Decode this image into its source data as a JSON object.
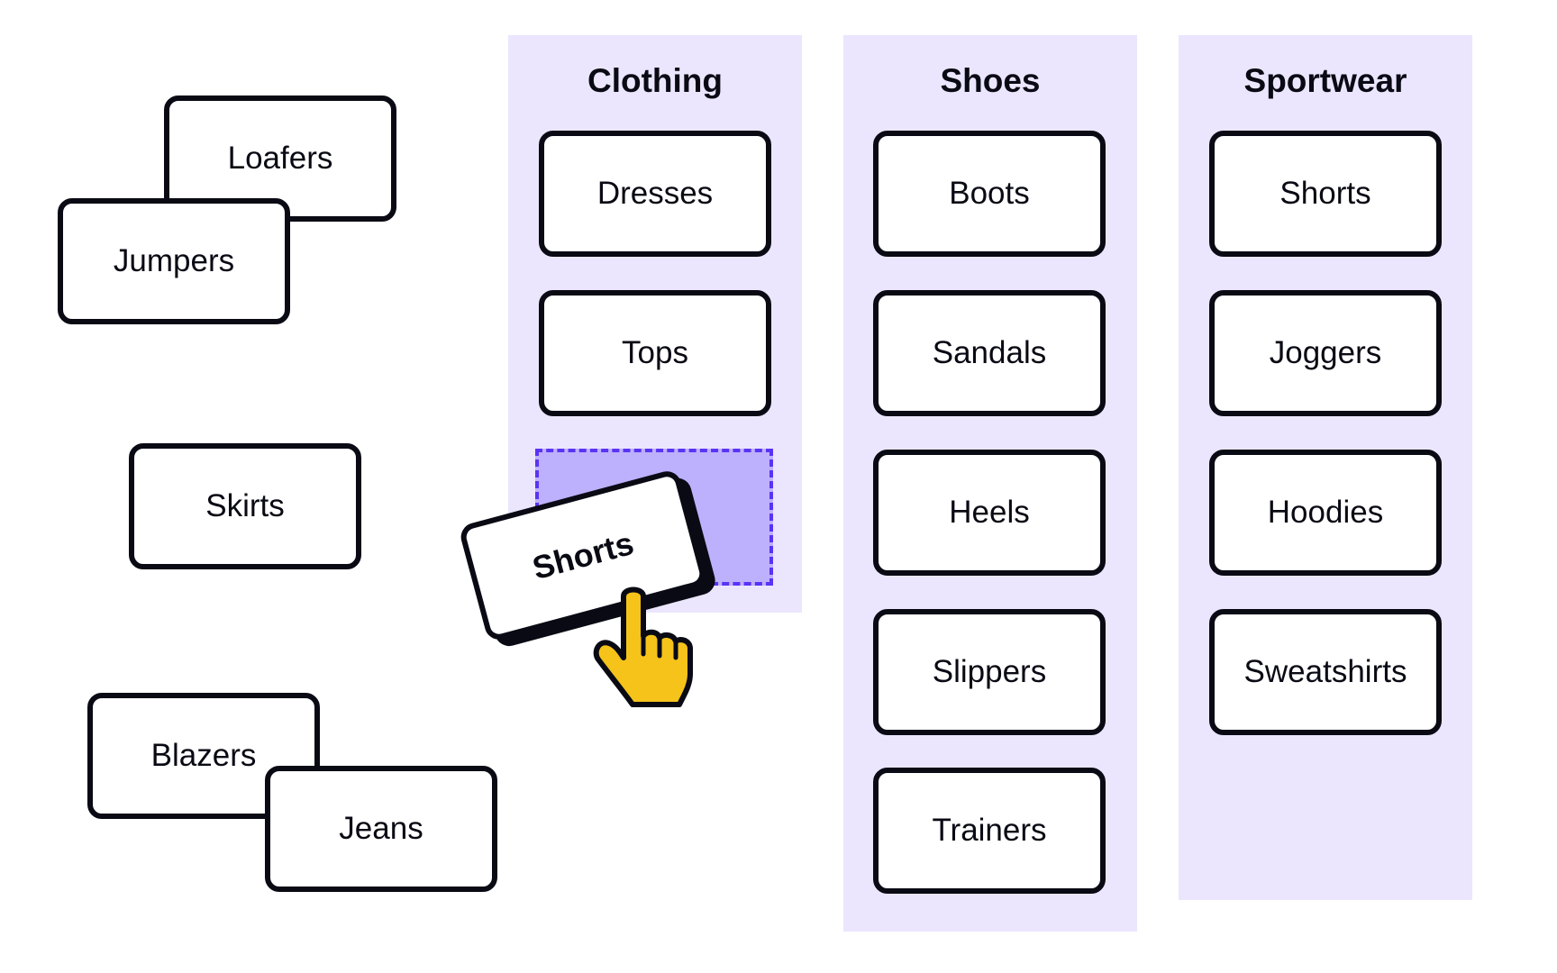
{
  "loose_cards": [
    {
      "label": "Loafers"
    },
    {
      "label": "Jumpers"
    },
    {
      "label": "Skirts"
    },
    {
      "label": "Blazers"
    },
    {
      "label": "Jeans"
    }
  ],
  "columns": [
    {
      "title": "Clothing",
      "items": [
        "Dresses",
        "Tops"
      ],
      "drop_zone": true
    },
    {
      "title": "Shoes",
      "items": [
        "Boots",
        "Sandals",
        "Heels",
        "Slippers",
        "Trainers"
      ]
    },
    {
      "title": "Sportwear",
      "items": [
        "Shorts",
        "Joggers",
        "Hoodies",
        "Sweatshirts"
      ]
    }
  ],
  "dragged_card": {
    "label": "Shorts"
  },
  "cursor": {
    "icon": "pointing-hand-icon",
    "color": "#f5c319"
  },
  "colors": {
    "column_bg": "#ebe6fd",
    "drop_zone_fill": "#bdb0fc",
    "drop_zone_border": "#5a33f5",
    "card_border": "#0a0a14"
  }
}
